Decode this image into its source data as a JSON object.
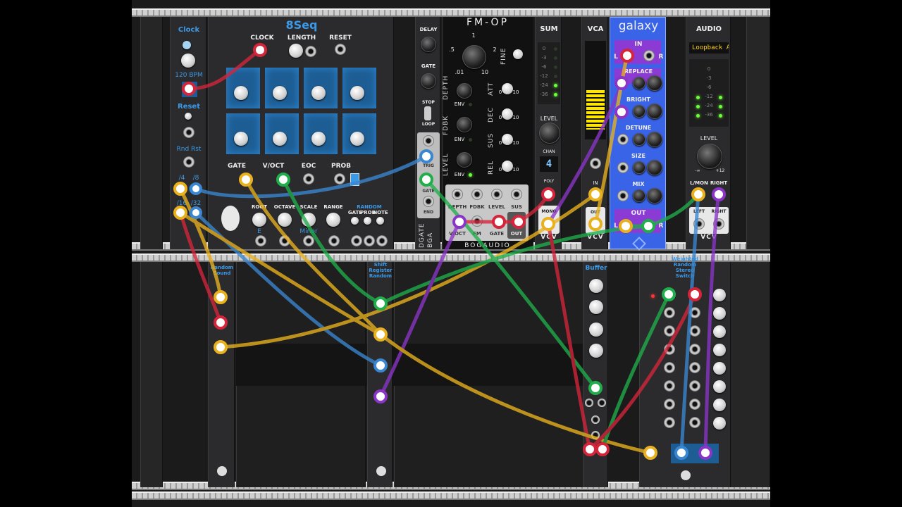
{
  "modules": {
    "clock": {
      "title": "Clock",
      "bpm": "120 BPM",
      "reset": "Reset",
      "rndrst": "Rnd Rst",
      "div1": "/4",
      "div2": "/8",
      "div3": "/16",
      "div4": "/32"
    },
    "seq": {
      "title": "8Seq",
      "clock": "CLOCK",
      "length": "LENGTH",
      "reset": "RESET",
      "gate": "GATE",
      "voct": "V/OCT",
      "eoc": "EOC",
      "prob": "PROB",
      "root": "ROOT",
      "octave": "OCTAVE",
      "scale": "SCALE",
      "range": "RANGE",
      "random": "RANDOM",
      "rgate": "GATE",
      "rprob": "PROB",
      "rnote": "NOTE",
      "root_val": "E",
      "scale_val": "Minor"
    },
    "dgate": {
      "delay": "DELAY",
      "gate": "GATE",
      "stop": "STOP",
      "loop": "LOOP",
      "trig": "TRIG",
      "gate2": "GATE",
      "end": "END",
      "name": "DGATE",
      "brand": "BGA"
    },
    "fmop": {
      "title": "FM-OP",
      "fine": "FINE",
      "depth": "DEPTH",
      "fdbk": "FDBK",
      "level": "LEVEL",
      "att": "ATT",
      "dec": "DEC",
      "sus": "SUS",
      "rel": "REL",
      "env": "ENV",
      "j_depth": "DEPTH",
      "j_fdbk": "FDBK",
      "j_level": "LEVEL",
      "j_sus": "SUS",
      "j_voct": "V/OCT",
      "j_fm": "FM",
      "j_gate": "GATE",
      "j_out": "OUT",
      "brand": "BOGAUDIO",
      "k1": "1",
      "k5": ".5",
      "k01": ".01",
      "k10": "10",
      "k2": "2",
      "k0": "0",
      "k10b": "10",
      "k0b": "0",
      "k10c": "10",
      "k0c": "0",
      "k10d": "10",
      "k0d": "0",
      "k10e": "10"
    },
    "sum": {
      "title": "SUM",
      "level": "LEVEL",
      "chan": "CHAN",
      "chan_val": "4",
      "poly": "POLY",
      "mono": "MONO",
      "brand": "VCV",
      "db": [
        "0",
        "-3",
        "-6",
        "-12",
        "-24",
        "-36"
      ]
    },
    "vca": {
      "title": "VCA",
      "in": "IN",
      "out": "OUT",
      "brand": "VCV"
    },
    "galaxy": {
      "title": "galaxy",
      "in": "IN",
      "l": "L",
      "r": "R",
      "replace": "REPLACE",
      "bright": "BRIGHT",
      "detune": "DETUNE",
      "size": "SIZE",
      "mix": "MIX",
      "out": "OUT",
      "ol": "L",
      "or": "R"
    },
    "audio": {
      "title": "AUDIO",
      "device": "Loopback Au",
      "level": "LEVEL",
      "lmon": "L/MON",
      "right": "RIGHT",
      "left": "LEFT",
      "right2": "RIGHT",
      "brand": "VCV",
      "min": "-∞",
      "max": "+12",
      "db": [
        "0",
        "-3",
        "-6",
        "-12",
        "-24",
        "-36"
      ]
    },
    "randsound": {
      "title1": "Random",
      "title2": "Sound"
    },
    "shift": {
      "t1": "Shift",
      "t2": "Register",
      "t3": "Random"
    },
    "buffer": {
      "title": "Buffer"
    },
    "wrss": {
      "t1": "Weighted",
      "t2": "Random",
      "t3": "Stereo",
      "t4": "Switch"
    }
  },
  "colors": {
    "yellow": "#e9b11e",
    "red": "#d4253b",
    "green": "#1fae4a",
    "blue": "#3a86d0",
    "purple": "#8a35c8",
    "accent": "#3b9ae8"
  }
}
